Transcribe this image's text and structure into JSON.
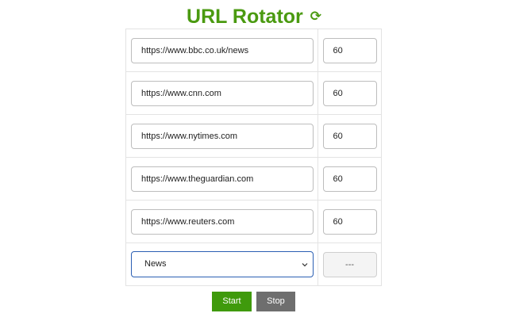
{
  "header": {
    "title": "URL Rotator",
    "icon": "⟳",
    "color": "#4a9a10"
  },
  "rows": [
    {
      "url": "https://www.bbc.co.uk/news",
      "seconds": "60"
    },
    {
      "url": "https://www.cnn.com",
      "seconds": "60"
    },
    {
      "url": "https://www.nytimes.com",
      "seconds": "60"
    },
    {
      "url": "https://www.theguardian.com",
      "seconds": "60"
    },
    {
      "url": "https://www.reuters.com",
      "seconds": "60"
    }
  ],
  "preset": {
    "selected": "News",
    "seconds_placeholder": "---"
  },
  "controls": {
    "start_label": "Start",
    "stop_label": "Stop",
    "start_color": "#3f9a0c",
    "stop_color": "#6e6e6e"
  }
}
